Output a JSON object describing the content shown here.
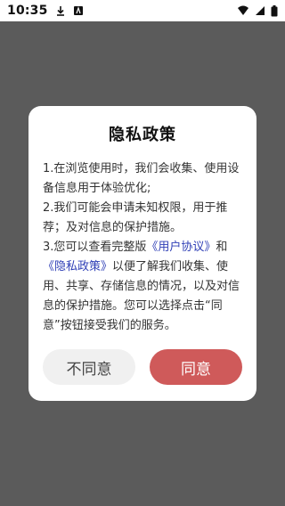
{
  "statusbar": {
    "time": "10:35",
    "icons": {
      "left": [
        "download-icon",
        "notification-icon"
      ],
      "right": [
        "wifi-icon",
        "signal-icon",
        "battery-icon"
      ]
    }
  },
  "dialog": {
    "title": "隐私政策",
    "body": {
      "p1": "1.在浏览使用时，我们会收集、使用设备信息用于体验优化;",
      "p2": "2.我们可能会申请未知权限，用于推荐；及对信息的保护措施。",
      "p3_prefix": "3.您可以查看完整版",
      "link_user_agreement": "《用户协议》",
      "and": "和",
      "link_privacy_policy": "《隐私政策》",
      "p3_suffix": "以便了解我们收集、使用、共享、存储信息的情况，以及对信息的保护措施。您可以选择点击“同意”按钮接受我们的服务。"
    },
    "buttons": {
      "disagree": "不同意",
      "agree": "同意"
    }
  },
  "colors": {
    "overlay": "#5b5b5b",
    "agree_button": "#cf5a5a",
    "disagree_button": "#f0f0f0",
    "link": "#2f3fb6"
  }
}
